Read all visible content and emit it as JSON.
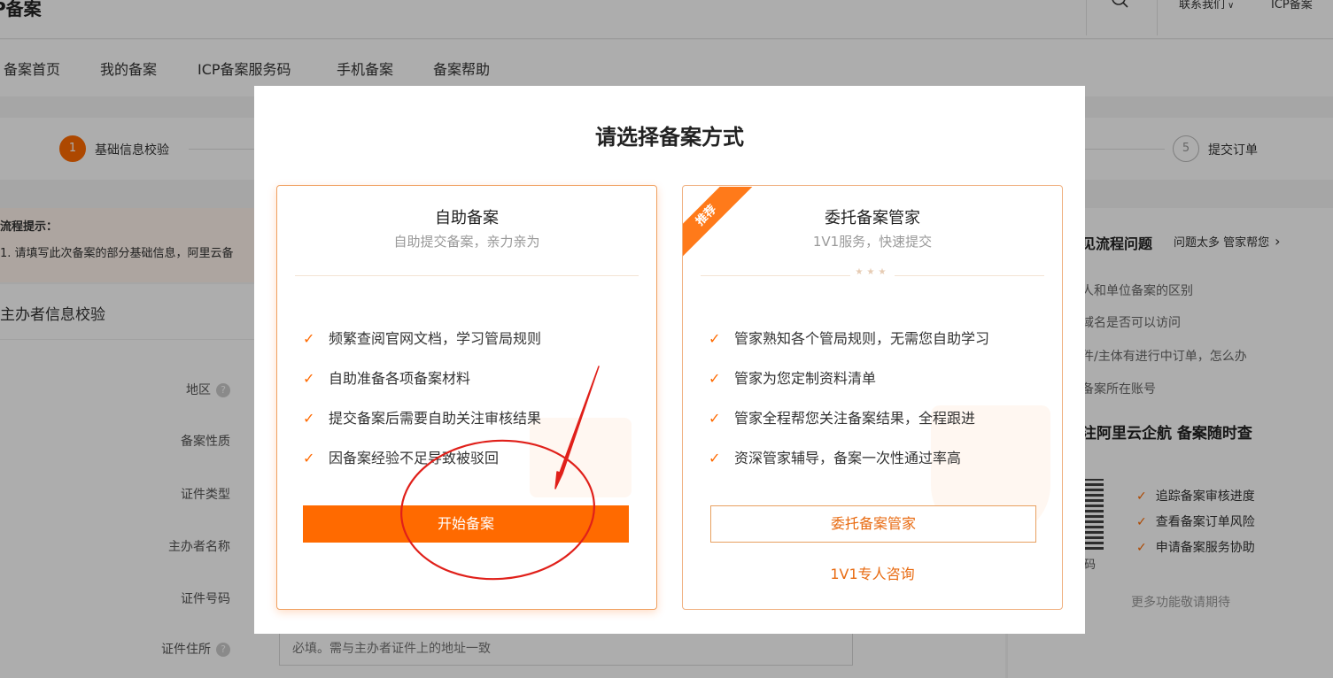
{
  "header": {
    "brand": "P备案",
    "contact": "联系我们",
    "icp_link": "ICP备案"
  },
  "nav": {
    "items": [
      "备案首页",
      "我的备案",
      "ICP备案服务码",
      "手机备案",
      "备案帮助"
    ]
  },
  "steps": [
    {
      "number": "1",
      "label": "基础信息校验",
      "active": true
    },
    {
      "number": "5",
      "label": "提交订单",
      "active": false
    }
  ],
  "tip": {
    "title": "流程提示：",
    "text": "1. 请填写此次备案的部分基础信息，阿里云备"
  },
  "form": {
    "section_title": "主办者信息校验",
    "labels": [
      "地区",
      "备案性质",
      "证件类型",
      "主办者名称",
      "证件号码",
      "证件住所"
    ],
    "address_placeholder": "必填。需与主办者证件上的地址一致"
  },
  "sidebar": {
    "title": "见流程问题",
    "more": "问题太多 管家帮您",
    "links": [
      "人和单位备案的区别",
      "域名是否可以访问",
      "件/主体有进行中订单，怎么办",
      "备案所在账号"
    ],
    "promo": "注阿里云企航 备案随时查",
    "qr_label": "码",
    "features": [
      "追踪备案审核进度",
      "查看备案订单风险",
      "申请备案服务协助"
    ],
    "footer": "更多功能敬请期待"
  },
  "modal": {
    "title": "请选择备案方式",
    "self_card": {
      "title": "自助备案",
      "subtitle": "自助提交备案，亲力亲为",
      "features": [
        "频繁查阅官网文档，学习管局规则",
        "自助准备各项备案材料",
        "提交备案后需要自助关注审核结果",
        "因备案经验不足导致被驳回"
      ],
      "button": "开始备案"
    },
    "agent_card": {
      "badge": "推荐",
      "title": "委托备案管家",
      "subtitle": "1V1服务，快速提交",
      "stars": "★★★",
      "features": [
        "管家熟知各个管局规则，无需您自助学习",
        "管家为您定制资料清单",
        "管家全程帮您关注备案结果，全程跟进",
        "资深管家辅导，备案一次性通过率高"
      ],
      "button": "委托备案管家",
      "consult": "1V1专人咨询"
    }
  },
  "colors": {
    "accent": "#ff6a00",
    "annotation_red": "#e0201a",
    "overlay": "rgba(0,0,0,0.32)"
  },
  "icons": {
    "check": "✓",
    "search": "search-icon",
    "chevron_down": "⌵",
    "chevron_right": "›",
    "help": "?"
  }
}
